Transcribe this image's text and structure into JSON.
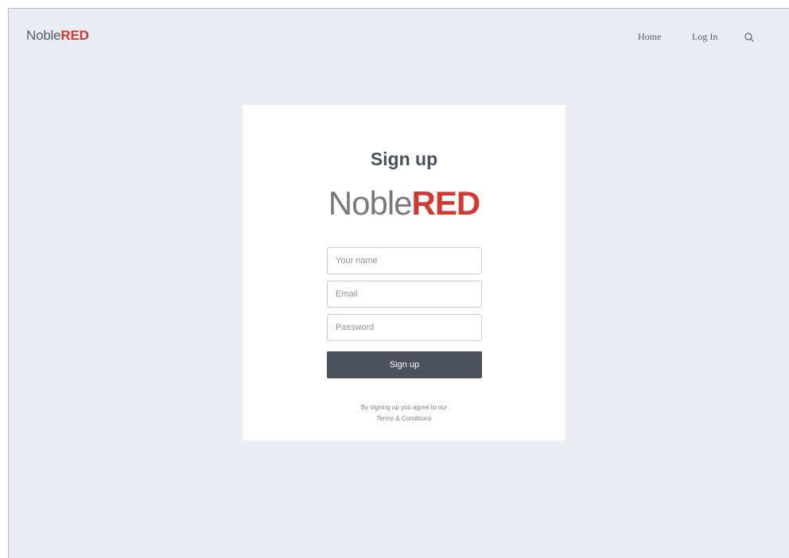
{
  "header": {
    "brand_prefix": "Noble",
    "brand_suffix": "RED",
    "nav": {
      "home": "Home",
      "login": "Log In"
    },
    "search_icon": "search-icon"
  },
  "signup": {
    "title": "Sign up",
    "logo_prefix": "Noble",
    "logo_suffix": "RED",
    "name_placeholder": "Your name",
    "email_placeholder": "Email",
    "password_placeholder": "Password",
    "submit_label": "Sign up",
    "agreement_text": "By signing up you agree to our",
    "terms_link": "Terms & Conditions"
  },
  "colors": {
    "background": "#eaecf3",
    "brand_red": "#d13a32",
    "button": "#4b525e"
  }
}
